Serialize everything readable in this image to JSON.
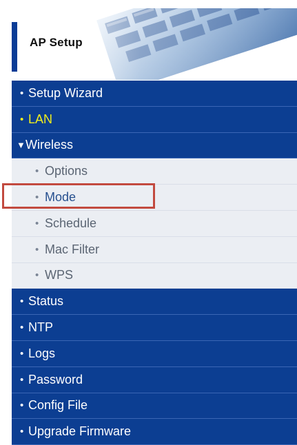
{
  "header": {
    "title": "AP Setup"
  },
  "menu": {
    "items": [
      {
        "label": "Setup Wizard"
      },
      {
        "label": "LAN"
      },
      {
        "label": "Wireless"
      },
      {
        "label": "Options"
      },
      {
        "label": "Mode"
      },
      {
        "label": "Schedule"
      },
      {
        "label": "Mac Filter"
      },
      {
        "label": "WPS"
      },
      {
        "label": "Status"
      },
      {
        "label": "NTP"
      },
      {
        "label": "Logs"
      },
      {
        "label": "Password"
      },
      {
        "label": "Config File"
      },
      {
        "label": "Upgrade Firmware"
      }
    ]
  },
  "colors": {
    "menu_blue": "#0c3e92",
    "submenu_bg": "#ebeef3",
    "active_yellow": "#f2f01c",
    "highlight_red": "#c24a3f"
  },
  "icons": {
    "bullet": "bullet-icon",
    "expanded": "triangle-down-icon"
  }
}
